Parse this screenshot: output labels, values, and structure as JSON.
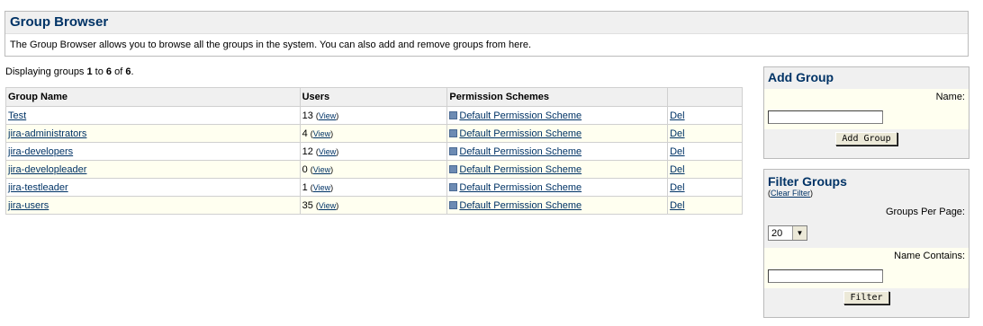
{
  "header": {
    "title": "Group Browser",
    "description": "The Group Browser allows you to browse all the groups in the system. You can also add and remove groups from here."
  },
  "displaying": {
    "prefix": "Displaying groups ",
    "from": "1",
    "to_word": " to ",
    "to": "6",
    "of_word": " of ",
    "total": "6",
    "suffix": "."
  },
  "table": {
    "headers": {
      "name": "Group Name",
      "users": "Users",
      "schemes": "Permission Schemes",
      "del": ""
    },
    "view_label": "View",
    "rows": [
      {
        "name": "Test",
        "users": "13",
        "scheme": "Default Permission Scheme",
        "del": "Del"
      },
      {
        "name": "jira-administrators",
        "users": "4",
        "scheme": "Default Permission Scheme",
        "del": "Del"
      },
      {
        "name": "jira-developers",
        "users": "12",
        "scheme": "Default Permission Scheme",
        "del": "Del"
      },
      {
        "name": "jira-developleader",
        "users": "0",
        "scheme": "Default Permission Scheme",
        "del": "Del"
      },
      {
        "name": "jira-testleader",
        "users": "1",
        "scheme": "Default Permission Scheme",
        "del": "Del"
      },
      {
        "name": "jira-users",
        "users": "35",
        "scheme": "Default Permission Scheme",
        "del": "Del"
      }
    ]
  },
  "add_group": {
    "title": "Add Group",
    "name_label": "Name:",
    "name_value": "",
    "button": "Add Group"
  },
  "filter": {
    "title": "Filter Groups",
    "clear": "Clear Filter",
    "per_page_label": "Groups Per Page:",
    "per_page_value": "20",
    "contains_label": "Name Contains:",
    "contains_value": "",
    "button": "Filter"
  }
}
